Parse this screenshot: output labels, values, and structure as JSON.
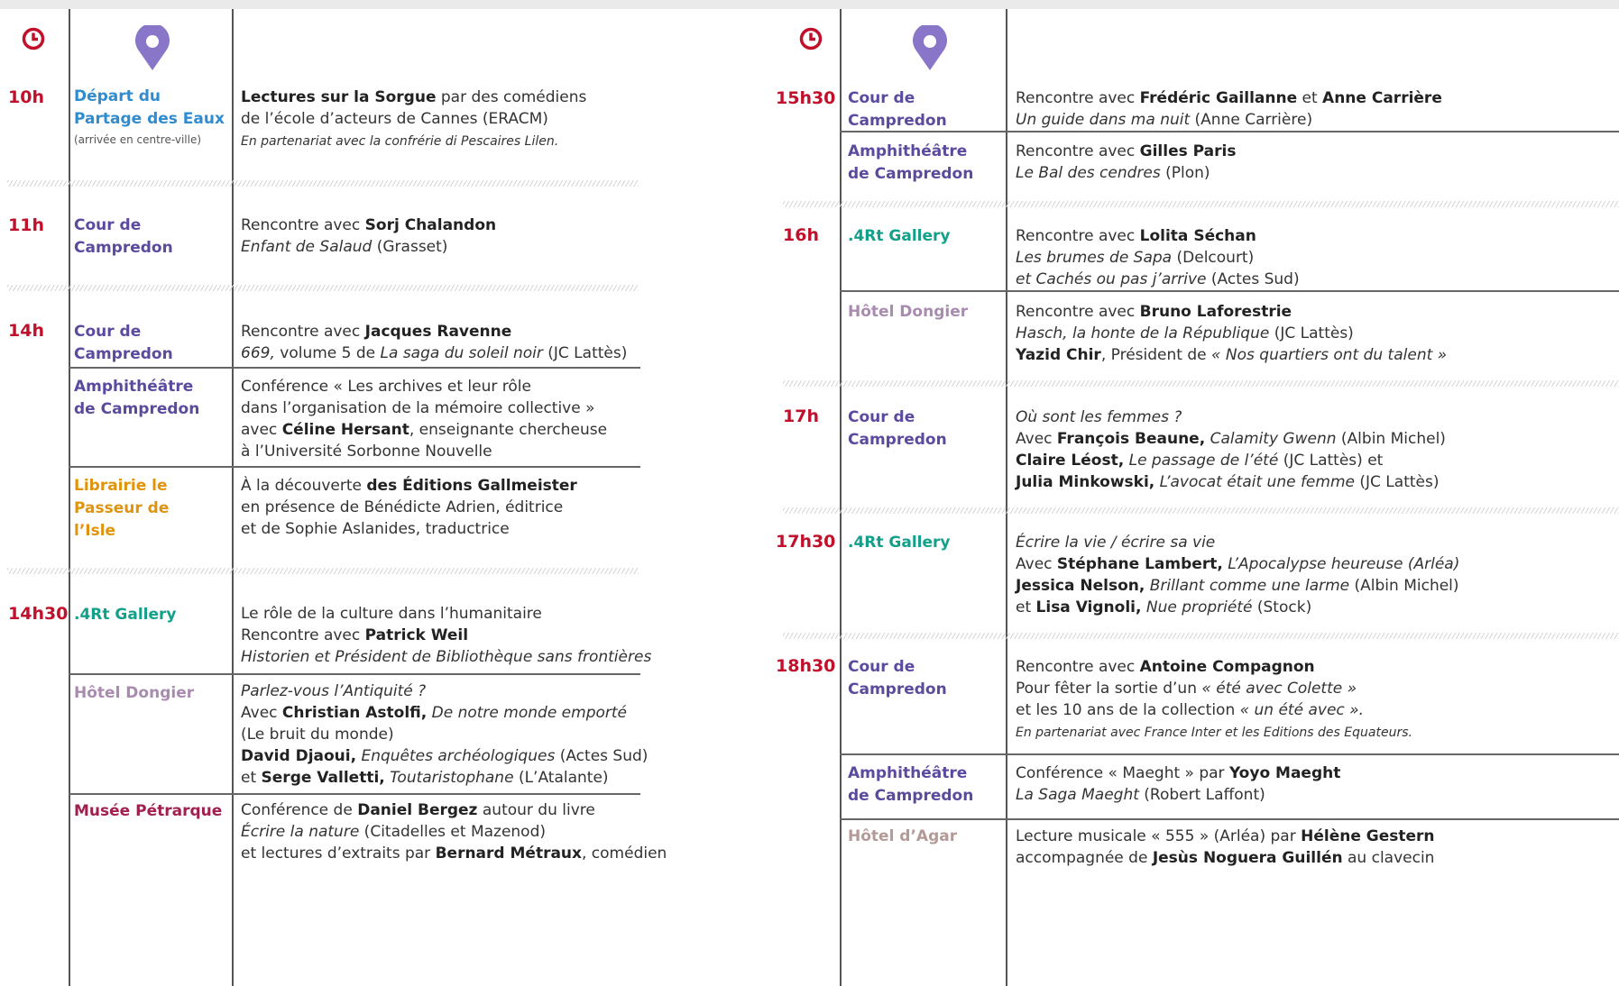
{
  "icons": {
    "clock": "clock-icon",
    "pin": "map-pin-icon",
    "clock_color": "#c0102b",
    "pin_color": "#8a76c9"
  },
  "left": {
    "slots": [
      {
        "time": "10h",
        "rows": [
          {
            "venue": "Départ du Partage des Eaux",
            "venue_sub": "(arrivée en centre-ville)",
            "lines": [
              [
                {
                  "t": "Lectures sur la Sorgue",
                  "s": "b"
                },
                {
                  "t": " par des comédiens"
                }
              ],
              [
                {
                  "t": "de l’école d’acteurs de Cannes (ERACM)"
                }
              ],
              [
                {
                  "t": "En partenariat avec la confrérie di Pescaires Lilen.",
                  "s": "sm"
                }
              ]
            ]
          }
        ]
      },
      {
        "time": "11h",
        "rows": [
          {
            "venue": "Cour de Campredon",
            "lines": [
              [
                {
                  "t": "Rencontre avec "
                },
                {
                  "t": "Sorj Chalandon",
                  "s": "b"
                }
              ],
              [
                {
                  "t": "Enfant de Salaud",
                  "s": "i"
                },
                {
                  "t": " (Grasset)"
                }
              ]
            ]
          }
        ]
      },
      {
        "time": "14h",
        "rows": [
          {
            "venue": "Cour de Campredon",
            "lines": [
              [
                {
                  "t": "Rencontre avec "
                },
                {
                  "t": "Jacques Ravenne",
                  "s": "b"
                }
              ],
              [
                {
                  "t": "669,",
                  "s": "i"
                },
                {
                  "t": " volume 5 de "
                },
                {
                  "t": "La saga du soleil noir",
                  "s": "i"
                },
                {
                  "t": " (JC Lattès)"
                }
              ]
            ]
          },
          {
            "venue": "Amphithéâtre de Campredon",
            "lines": [
              [
                {
                  "t": "Conférence « Les archives et leur rôle"
                }
              ],
              [
                {
                  "t": "dans l’organisation de la mémoire collective »"
                }
              ],
              [
                {
                  "t": "avec "
                },
                {
                  "t": "Céline Hersant",
                  "s": "b"
                },
                {
                  "t": ", enseignante chercheuse"
                }
              ],
              [
                {
                  "t": "à l’Université Sorbonne Nouvelle"
                }
              ]
            ]
          },
          {
            "venue": "Librairie le Passeur de l’Isle",
            "lines": [
              [
                {
                  "t": "À la découverte "
                },
                {
                  "t": "des Éditions Gallmeister",
                  "s": "b"
                }
              ],
              [
                {
                  "t": "en présence de Bénédicte Adrien, éditrice"
                }
              ],
              [
                {
                  "t": "et de Sophie Aslanides, traductrice"
                }
              ]
            ]
          }
        ]
      },
      {
        "time": "14h30",
        "rows": [
          {
            "venue": ".4Rt Gallery",
            "lines": [
              [
                {
                  "t": "Le rôle de la culture dans l’humanitaire"
                }
              ],
              [
                {
                  "t": "Rencontre avec "
                },
                {
                  "t": "Patrick Weil",
                  "s": "b"
                }
              ],
              [
                {
                  "t": "Historien et Président de Bibliothèque sans frontières",
                  "s": "i"
                }
              ]
            ]
          },
          {
            "venue": "Hôtel Dongier",
            "lines": [
              [
                {
                  "t": "Parlez-vous l’Antiquité ?",
                  "s": "i"
                }
              ],
              [
                {
                  "t": "Avec "
                },
                {
                  "t": "Christian Astolfi,",
                  "s": "b"
                },
                {
                  "t": " "
                },
                {
                  "t": "De notre monde emporté",
                  "s": "i"
                }
              ],
              [
                {
                  "t": "(Le bruit du monde)"
                }
              ],
              [
                {
                  "t": "David Djaoui,",
                  "s": "b"
                },
                {
                  "t": " "
                },
                {
                  "t": "Enquêtes archéologiques",
                  "s": "i"
                },
                {
                  "t": " (Actes Sud)"
                }
              ],
              [
                {
                  "t": "et "
                },
                {
                  "t": "Serge Valletti,",
                  "s": "b"
                },
                {
                  "t": " "
                },
                {
                  "t": "Toutaristophane",
                  "s": "i"
                },
                {
                  "t": " (L’Atalante)"
                }
              ]
            ]
          },
          {
            "venue": "Musée Pétrarque",
            "lines": [
              [
                {
                  "t": "Conférence de "
                },
                {
                  "t": "Daniel Bergez",
                  "s": "b"
                },
                {
                  "t": " autour du livre"
                }
              ],
              [
                {
                  "t": "Écrire la nature",
                  "s": "i"
                },
                {
                  "t": " (Citadelles et Mazenod)"
                }
              ],
              [
                {
                  "t": "et lectures d’extraits par "
                },
                {
                  "t": "Bernard Métraux",
                  "s": "b"
                },
                {
                  "t": ", comédien"
                }
              ]
            ]
          }
        ]
      }
    ]
  },
  "right": {
    "slots": [
      {
        "time": "15h30",
        "rows": [
          {
            "venue": "Cour de Campredon",
            "lines": [
              [
                {
                  "t": "Rencontre avec "
                },
                {
                  "t": "Frédéric Gaillanne",
                  "s": "b"
                },
                {
                  "t": " et "
                },
                {
                  "t": "Anne Carrière",
                  "s": "b"
                }
              ],
              [
                {
                  "t": "Un guide dans ma nuit",
                  "s": "i"
                },
                {
                  "t": " (Anne Carrière)"
                }
              ]
            ]
          },
          {
            "venue": "Amphithéâtre de Campredon",
            "lines": [
              [
                {
                  "t": "Rencontre avec "
                },
                {
                  "t": "Gilles Paris",
                  "s": "b"
                }
              ],
              [
                {
                  "t": "Le Bal des cendres",
                  "s": "i"
                },
                {
                  "t": " (Plon)"
                }
              ]
            ]
          }
        ]
      },
      {
        "time": "16h",
        "rows": [
          {
            "venue": ".4Rt Gallery",
            "lines": [
              [
                {
                  "t": "Rencontre avec "
                },
                {
                  "t": "Lolita Séchan",
                  "s": "b"
                }
              ],
              [
                {
                  "t": "Les brumes de Sapa",
                  "s": "i"
                },
                {
                  "t": " (Delcourt)"
                }
              ],
              [
                {
                  "t": "et Cachés ou pas j’arrive",
                  "s": "i"
                },
                {
                  "t": " (Actes Sud)"
                }
              ]
            ]
          },
          {
            "venue": "Hôtel Dongier",
            "lines": [
              [
                {
                  "t": "Rencontre avec "
                },
                {
                  "t": "Bruno Laforestrie",
                  "s": "b"
                }
              ],
              [
                {
                  "t": "Hasch, la honte de la République",
                  "s": "i"
                },
                {
                  "t": " (JC Lattès)"
                }
              ],
              [
                {
                  "t": "Yazid Chir",
                  "s": "b"
                },
                {
                  "t": ", Président de "
                },
                {
                  "t": "« Nos quartiers ont du talent »",
                  "s": "i"
                }
              ]
            ]
          }
        ]
      },
      {
        "time": "17h",
        "rows": [
          {
            "venue": "Cour de Campredon",
            "lines": [
              [
                {
                  "t": "Où sont les femmes ?",
                  "s": "i"
                }
              ],
              [
                {
                  "t": "Avec "
                },
                {
                  "t": "François Beaune,",
                  "s": "b"
                },
                {
                  "t": " "
                },
                {
                  "t": "Calamity Gwenn",
                  "s": "i"
                },
                {
                  "t": " (Albin Michel)"
                }
              ],
              [
                {
                  "t": "Claire Léost,",
                  "s": "b"
                },
                {
                  "t": " "
                },
                {
                  "t": "Le passage de l’été",
                  "s": "i"
                },
                {
                  "t": " (JC Lattès) et"
                }
              ],
              [
                {
                  "t": "Julia Minkowski,",
                  "s": "b"
                },
                {
                  "t": " "
                },
                {
                  "t": "L’avocat était une femme",
                  "s": "i"
                },
                {
                  "t": " (JC Lattès)"
                }
              ]
            ]
          }
        ]
      },
      {
        "time": "17h30",
        "rows": [
          {
            "venue": ".4Rt Gallery",
            "lines": [
              [
                {
                  "t": "Écrire la vie / écrire sa vie",
                  "s": "i"
                }
              ],
              [
                {
                  "t": "Avec "
                },
                {
                  "t": "Stéphane Lambert,",
                  "s": "b"
                },
                {
                  "t": " "
                },
                {
                  "t": "L’Apocalypse heureuse (Arléa)",
                  "s": "i"
                }
              ],
              [
                {
                  "t": "Jessica Nelson,",
                  "s": "b"
                },
                {
                  "t": " "
                },
                {
                  "t": "Brillant comme une larme",
                  "s": "i"
                },
                {
                  "t": " (Albin Michel)"
                }
              ],
              [
                {
                  "t": "et "
                },
                {
                  "t": "Lisa Vignoli,",
                  "s": "b"
                },
                {
                  "t": " "
                },
                {
                  "t": "Nue propriété",
                  "s": "i"
                },
                {
                  "t": " (Stock)"
                }
              ]
            ]
          }
        ]
      },
      {
        "time": "18h30",
        "rows": [
          {
            "venue": "Cour de Campredon",
            "lines": [
              [
                {
                  "t": "Rencontre avec "
                },
                {
                  "t": "Antoine Compagnon",
                  "s": "b"
                }
              ],
              [
                {
                  "t": "Pour fêter la sortie d’un "
                },
                {
                  "t": "« été avec Colette »",
                  "s": "i"
                }
              ],
              [
                {
                  "t": "et les 10 ans de la collection "
                },
                {
                  "t": "« un été avec ».",
                  "s": "i"
                }
              ],
              [
                {
                  "t": "En partenariat avec France Inter et les Editions des Equateurs.",
                  "s": "sm"
                }
              ]
            ]
          },
          {
            "venue": "Amphithéâtre de Campredon",
            "lines": [
              [
                {
                  "t": "Conférence « Maeght » par "
                },
                {
                  "t": "Yoyo Maeght",
                  "s": "b"
                }
              ],
              [
                {
                  "t": "La Saga Maeght",
                  "s": "i"
                },
                {
                  "t": " (Robert Laffont)"
                }
              ]
            ]
          },
          {
            "venue": "Hôtel d’Agar",
            "lines": [
              [
                {
                  "t": "Lecture musicale « 555 » (Arléa) par "
                },
                {
                  "t": "Hélène Gestern",
                  "s": "b"
                }
              ],
              [
                {
                  "t": "accompagnée de "
                },
                {
                  "t": "Jesùs Noguera Guillén",
                  "s": "b"
                },
                {
                  "t": " au clavecin"
                }
              ]
            ]
          }
        ]
      }
    ]
  }
}
